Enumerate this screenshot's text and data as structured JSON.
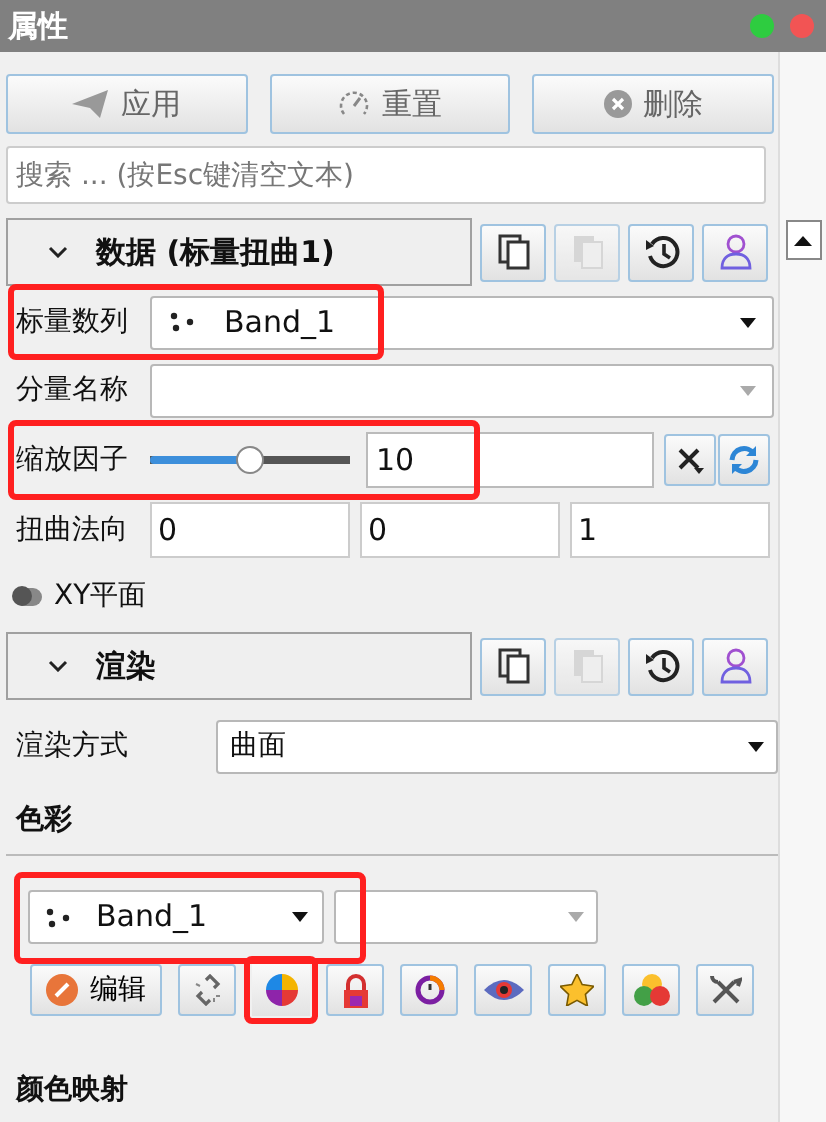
{
  "window": {
    "title": "属性"
  },
  "actions": [
    {
      "kind": "apply",
      "label": "应用"
    },
    {
      "kind": "reset",
      "label": "重置"
    },
    {
      "kind": "delete",
      "label": "删除"
    }
  ],
  "search": {
    "placeholder": "搜索 ... (按Esc键清空文本)"
  },
  "data_section": {
    "title": "数据 (标量扭曲1)",
    "expanded": true,
    "tools": [
      {
        "kind": "copy",
        "disabled": false
      },
      {
        "kind": "paste",
        "disabled": true
      },
      {
        "kind": "history",
        "disabled": false
      },
      {
        "kind": "user",
        "disabled": false
      }
    ]
  },
  "scalar_array": {
    "label": "标量数列",
    "value": "Band_1",
    "highlighted": true
  },
  "component_name": {
    "label": "分量名称"
  },
  "scale_factor": {
    "label": "缩放因子",
    "level": 0.5,
    "value": "10",
    "highlighted": true
  },
  "warp_normal": {
    "label": "扭曲法向",
    "values": [
      "0",
      "0",
      "1"
    ]
  },
  "xy_plane": {
    "label": "XY平面",
    "on": false
  },
  "render_section": {
    "title": "渲染",
    "expanded": true,
    "tools": [
      {
        "kind": "copy",
        "disabled": false
      },
      {
        "kind": "paste",
        "disabled": true
      },
      {
        "kind": "history",
        "disabled": false
      },
      {
        "kind": "user",
        "disabled": false
      }
    ]
  },
  "render_mode": {
    "label": "渲染方式",
    "value": "曲面"
  },
  "color": {
    "title": "色彩",
    "array": "Band_1",
    "array_highlighted": true,
    "tools": [
      {
        "kind": "edit",
        "label": "编辑",
        "highlighted": false
      },
      {
        "kind": "link",
        "highlighted": false
      },
      {
        "kind": "wheel",
        "highlighted": true
      },
      {
        "kind": "lock",
        "highlighted": false
      },
      {
        "kind": "ring",
        "highlighted": false
      },
      {
        "kind": "eye",
        "highlighted": false
      },
      {
        "kind": "star",
        "highlighted": false
      },
      {
        "kind": "circles",
        "highlighted": false
      },
      {
        "kind": "tools",
        "highlighted": false
      }
    ]
  },
  "color_map": {
    "title": "颜色映射"
  }
}
